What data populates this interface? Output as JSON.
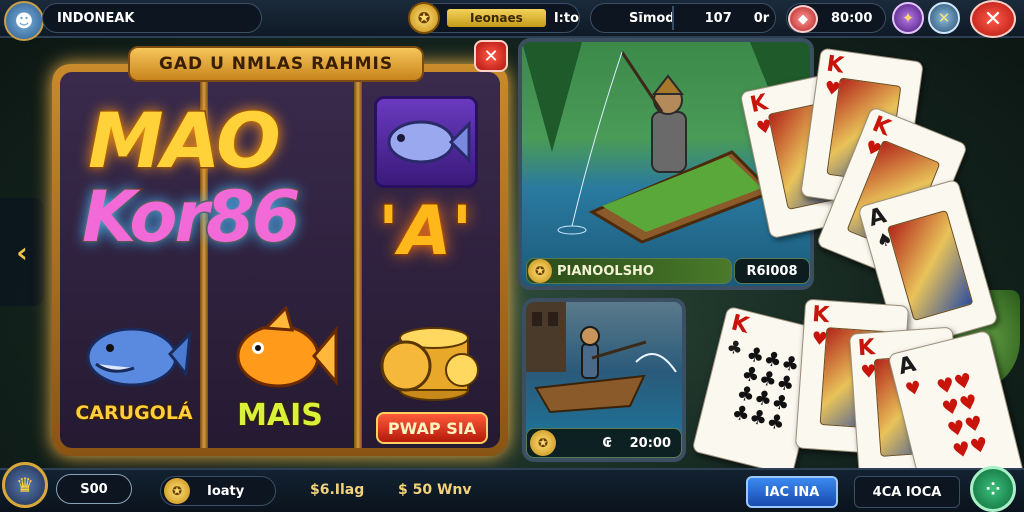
{
  "top": {
    "player_name": "INDONEAK",
    "coin_bar_label": "Ieonaes",
    "coin_amount": "I:to",
    "stat_label": "Sīmod",
    "stat_value_1": "107",
    "stat_value_2": "0r",
    "gem_value": "80:00"
  },
  "slot": {
    "banner_title": "GAD U NMLAS RAHMIS",
    "logo_line1": "MAO",
    "logo_line2": "Kor86",
    "logo_a": "'A'",
    "reel_label_left": "CARUGOLÁ",
    "reel_label_mid": "MAIS",
    "reel_button": "PWAP SIA"
  },
  "tiles": {
    "fishing_name": "PIANOOLSHO",
    "fishing_value": "R6I008",
    "boat_value": "20:00",
    "boat_currency": "₢"
  },
  "bottom": {
    "balance": "S00",
    "coin_label": "Ioaty",
    "bet_label": "$6.Ilag",
    "win_label": "$ 50 Wnv",
    "btn_primary": "ІАС ІNА",
    "btn_secondary": "4СА ІОСА"
  },
  "icons": [
    "avatar-icon",
    "coin-icon",
    "gem-icon",
    "tools-icon",
    "close-icon",
    "chevron-left-icon",
    "crown-icon",
    "menu-icon"
  ],
  "colors": {
    "accent_gold": "#f2b347",
    "close_red": "#d92a1c",
    "primary_blue": "#2a6fd6"
  }
}
